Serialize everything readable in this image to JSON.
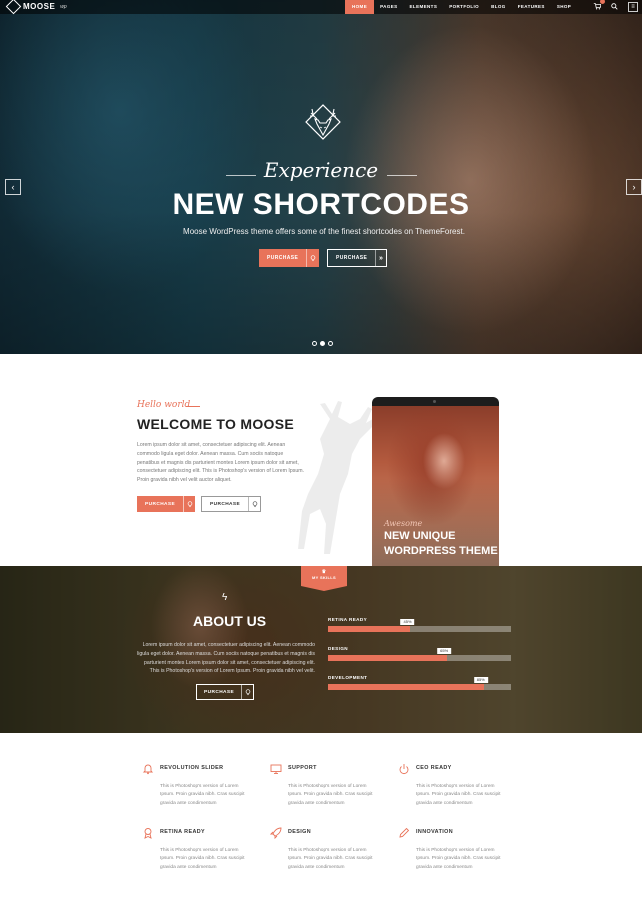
{
  "header": {
    "logo_text": "MOOSE",
    "logo_sup": "wp",
    "nav": [
      "HOME",
      "PAGES",
      "ELEMENTS",
      "PORTFOLIO",
      "BLOG",
      "FEATURES",
      "SHOP"
    ],
    "active_nav": "HOME"
  },
  "hero": {
    "script_title": "Experience",
    "headline": "NEW SHORTCODES",
    "subtitle": "Moose WordPress theme offers some of the finest shortcodes on ThemeForest.",
    "button1_label": "PURCHASE",
    "button2_label": "PURCHASE",
    "prev_arrow": "‹",
    "next_arrow": "›",
    "slides_total": 3,
    "active_slide": 2
  },
  "welcome": {
    "script": "Hello world",
    "title": "WELCOME TO MOOSE",
    "body": "Lorem ipsum dolor sit amet, consectetuer adipiscing elit. Aenean commodo ligula eget dolor. Aenean massa. Cum sociis natoque penatibus et magnis dis parturient montes Lorem ipsum dolor sit amet, consectetuer adipiscing elit. This is Photoshop's version of Lorem Ipsum. Proin gravida nibh vel velit auctor aliquet.",
    "button1_label": "PURCHASE",
    "button2_label": "PURCHASE",
    "tablet_script": "Awesome",
    "tablet_title_line1": "NEW UNIQUE",
    "tablet_title_line2": "WORDPRESS THEME"
  },
  "about": {
    "ribbon": "MY SKILLS",
    "title": "ABOUT US",
    "body": "Lorem ipsum dolor sit amet, consectetuer adipiscing elit. Aenean commodo ligula eget dolor. Aenean massa. Cum sociis natoque penatibus et magnis dis parturient montes Lorem ipsum dolor sit amet, consectetuer adipiscing elit. This is Photoshop's version of Lorem Ipsum. Proin gravida nibh vel velit.",
    "button_label": "PURCHASE",
    "skills": [
      {
        "label": "RETINA READY",
        "value": 45,
        "pct": "45%"
      },
      {
        "label": "DESIGN",
        "value": 65,
        "pct": "65%"
      },
      {
        "label": "DEVELOPMENT",
        "value": 85,
        "pct": "85%"
      }
    ]
  },
  "features": [
    {
      "title": "REVOLUTION SLIDER",
      "icon": "bell-icon",
      "text": "This is Photoshop's version of Lorem Ipsum. Proin gravida nibh. Cras suscipit gravida ante condimentum"
    },
    {
      "title": "SUPPORT",
      "icon": "monitor-icon",
      "text": "This is Photoshop's version of Lorem Ipsum. Proin gravida nibh. Cras suscipit gravida ante condimentum"
    },
    {
      "title": "CEO READY",
      "icon": "power-icon",
      "text": "This is Photoshop's version of Lorem Ipsum. Proin gravida nibh. Cras suscipit gravida ante condimentum"
    },
    {
      "title": "RETINA READY",
      "icon": "award-icon",
      "text": "This is Photoshop's version of Lorem Ipsum. Proin gravida nibh. Cras suscipit gravida ante condimentum"
    },
    {
      "title": "DESIGN",
      "icon": "rocket-icon",
      "text": "This is Photoshop's version of Lorem Ipsum. Proin gravida nibh. Cras suscipit gravida ante condimentum"
    },
    {
      "title": "INNOVATION",
      "icon": "pencil-icon",
      "text": "This is Photoshop's version of Lorem Ipsum. Proin gravida nibh. Cras suscipit gravida ante condimentum"
    }
  ],
  "colors": {
    "accent": "#e8735a",
    "dark_text": "#222222",
    "muted_text": "#888888"
  }
}
